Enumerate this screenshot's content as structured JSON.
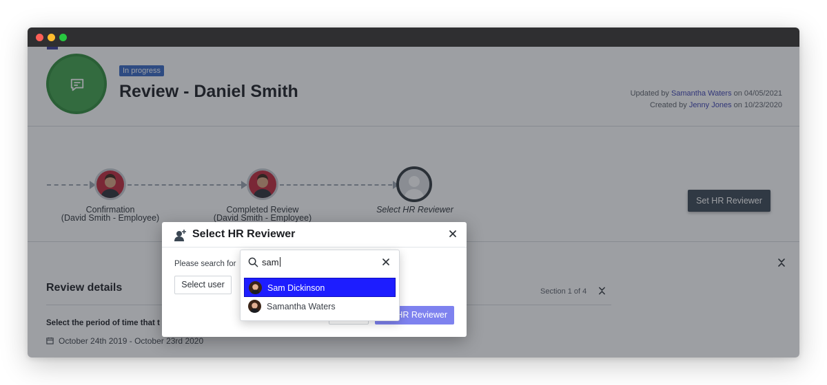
{
  "record": {
    "status": "In progress",
    "title": "Review - Daniel Smith",
    "updated_prefix": "Updated by",
    "updated_by": "Samantha Waters",
    "updated_on_text": "on 04/05/2021",
    "created_prefix": "Created by",
    "created_by": "Jenny Jones",
    "created_on_text": "on 10/23/2020"
  },
  "timeline": {
    "steps": [
      {
        "label": "Confirmation",
        "sublabel": "(David Smith - Employee)"
      },
      {
        "label": "Completed Review",
        "sublabel": "(David Smith - Employee)"
      },
      {
        "label": "Select HR Reviewer"
      }
    ],
    "action_label": "Set HR Reviewer"
  },
  "details": {
    "title": "Review details",
    "section_count": "Section 1 of 4",
    "question": "Select the period of time that t",
    "period": "October 24th 2019 - October 23rd 2020"
  },
  "modal": {
    "title": "Select HR Reviewer",
    "prompt": "Please search for",
    "select_user_label": "Select user",
    "primary_label": "HR Reviewer"
  },
  "dropdown": {
    "query": "sam",
    "options": [
      {
        "name": "Sam Dickinson",
        "selected": true
      },
      {
        "name": "Samantha Waters",
        "selected": false
      }
    ]
  },
  "colors": {
    "accent": "#3a3fb1",
    "status_badge": "#3566c4",
    "avatar_green": "#3fa14a",
    "selected_option": "#1d1dff",
    "primary_button": "#7e82ef",
    "dark_button": "#3a4652"
  },
  "icons": {
    "record_avatar": "message-square-icon",
    "modal_icon": "user-plus-icon",
    "close": "close-icon",
    "search": "search-icon",
    "collapse": "chevrons-collapse-icon",
    "calendar": "calendar-icon"
  }
}
